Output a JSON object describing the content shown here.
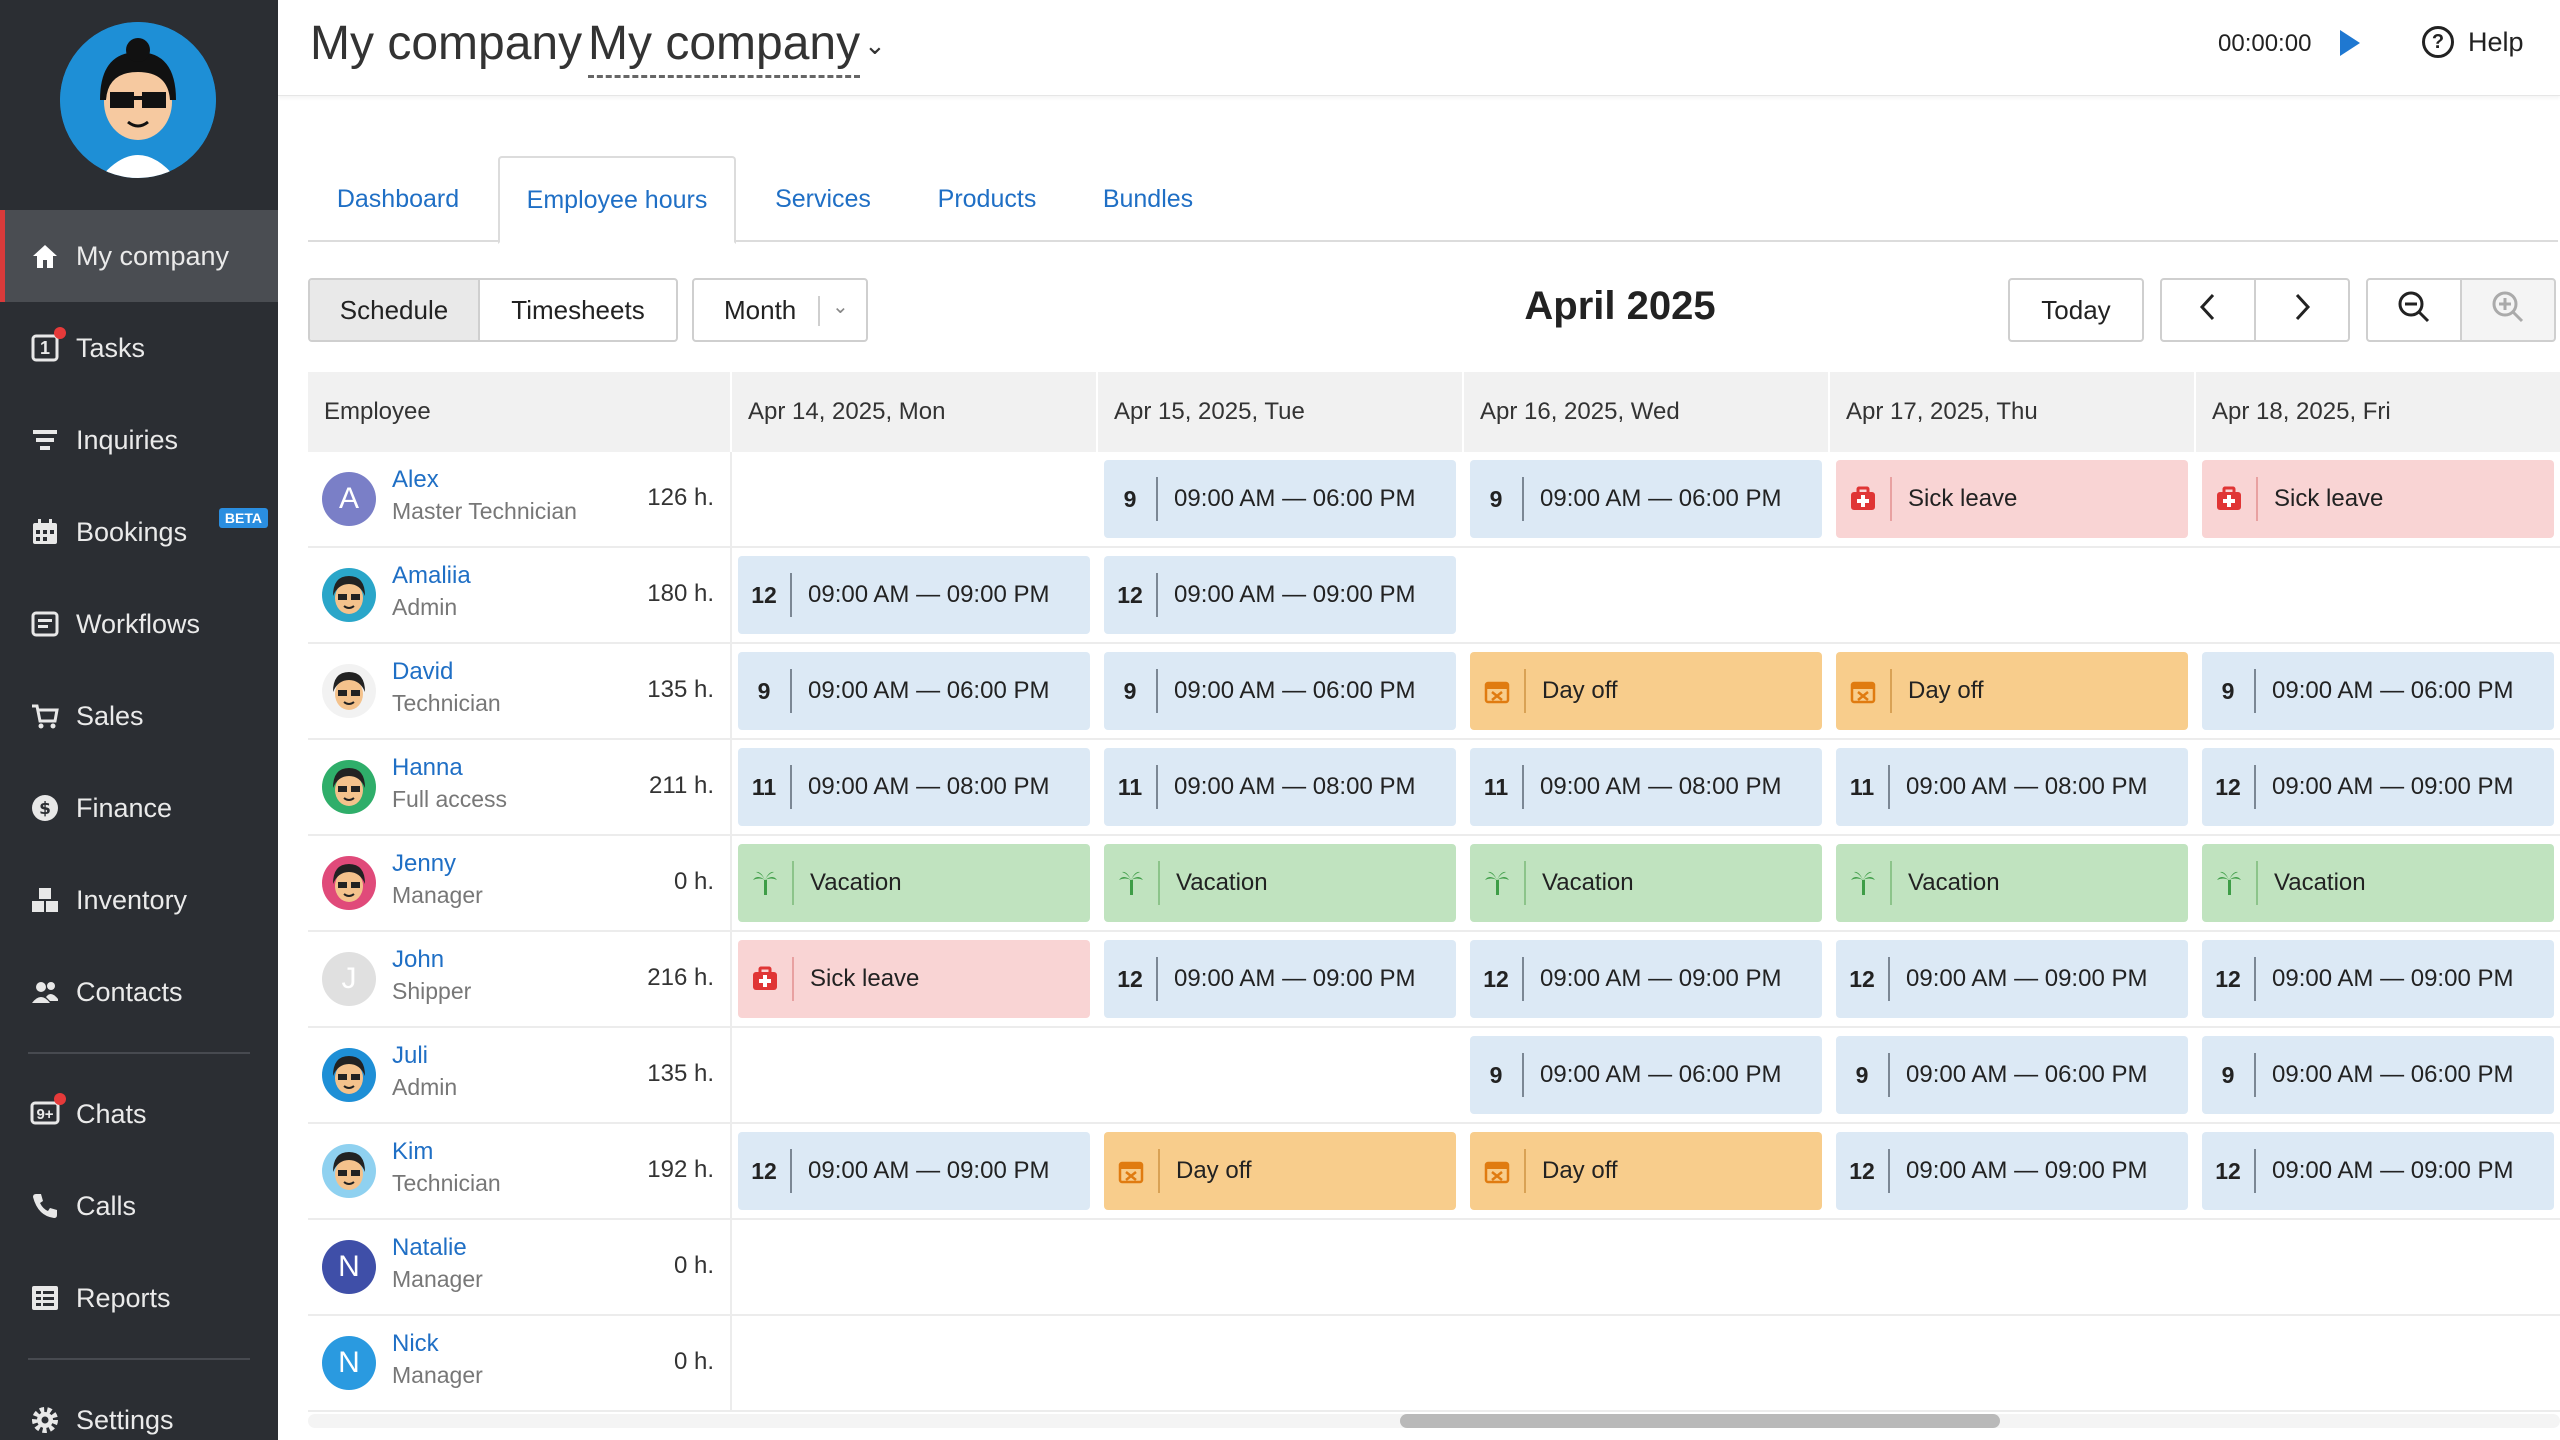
{
  "sidebar": {
    "items": [
      {
        "label": "My company",
        "icon": "home-icon",
        "active": true
      },
      {
        "label": "Tasks",
        "icon": "tasks-icon",
        "badge": "1"
      },
      {
        "label": "Inquiries",
        "icon": "filter-icon"
      },
      {
        "label": "Bookings",
        "icon": "calendar-icon",
        "tag": "BETA"
      },
      {
        "label": "Workflows",
        "icon": "workflow-icon"
      },
      {
        "label": "Sales",
        "icon": "cart-icon"
      },
      {
        "label": "Finance",
        "icon": "dollar-icon"
      },
      {
        "label": "Inventory",
        "icon": "boxes-icon"
      },
      {
        "label": "Contacts",
        "icon": "contacts-icon"
      },
      {
        "label": "Chats",
        "icon": "chat-icon",
        "badge": "9+"
      },
      {
        "label": "Calls",
        "icon": "phone-icon"
      },
      {
        "label": "Reports",
        "icon": "reports-icon"
      },
      {
        "label": "Settings",
        "icon": "gear-icon"
      }
    ]
  },
  "header": {
    "title": "My company",
    "company_select": "My company",
    "timer": "00:00:00",
    "help_label": "Help"
  },
  "tabs": [
    "Dashboard",
    "Employee hours",
    "Services",
    "Products",
    "Bundles"
  ],
  "toolbar": {
    "view_schedule": "Schedule",
    "view_timesheets": "Timesheets",
    "period_select": "Month",
    "period_title": "April 2025",
    "today_label": "Today"
  },
  "grid": {
    "employee_header": "Employee",
    "days": [
      "Apr 14, 2025, Mon",
      "Apr 15, 2025, Tue",
      "Apr 16, 2025, Wed",
      "Apr 17, 2025, Thu",
      "Apr 18, 2025, Fri"
    ],
    "employees": [
      {
        "name": "Alex",
        "role": "Master Technician",
        "hours": "126 h.",
        "avatar": "A",
        "avatar_color": "#7a7fc7",
        "cells": [
          null,
          {
            "type": "shift",
            "hrs": "9",
            "time": "09:00 AM — 06:00 PM"
          },
          {
            "type": "shift",
            "hrs": "9",
            "time": "09:00 AM — 06:00 PM"
          },
          {
            "type": "sick",
            "label": "Sick leave"
          },
          {
            "type": "sick",
            "label": "Sick leave"
          }
        ]
      },
      {
        "name": "Amaliia",
        "role": "Admin",
        "hours": "180 h.",
        "avatar": "",
        "avatar_color": "#2aa6c9",
        "cells": [
          {
            "type": "shift",
            "hrs": "12",
            "time": "09:00 AM — 09:00 PM"
          },
          {
            "type": "shift",
            "hrs": "12",
            "time": "09:00 AM — 09:00 PM"
          },
          null,
          null,
          null
        ]
      },
      {
        "name": "David",
        "role": "Technician",
        "hours": "135 h.",
        "avatar": "",
        "avatar_color": "#f2f2f2",
        "cells": [
          {
            "type": "shift",
            "hrs": "9",
            "time": "09:00 AM — 06:00 PM"
          },
          {
            "type": "shift",
            "hrs": "9",
            "time": "09:00 AM — 06:00 PM"
          },
          {
            "type": "off",
            "label": "Day off"
          },
          {
            "type": "off",
            "label": "Day off"
          },
          {
            "type": "shift",
            "hrs": "9",
            "time": "09:00 AM — 06:00 PM"
          }
        ]
      },
      {
        "name": "Hanna",
        "role": "Full access",
        "hours": "211 h.",
        "avatar": "",
        "avatar_color": "#2fae6a",
        "cells": [
          {
            "type": "shift",
            "hrs": "11",
            "time": "09:00 AM — 08:00 PM"
          },
          {
            "type": "shift",
            "hrs": "11",
            "time": "09:00 AM — 08:00 PM"
          },
          {
            "type": "shift",
            "hrs": "11",
            "time": "09:00 AM — 08:00 PM"
          },
          {
            "type": "shift",
            "hrs": "11",
            "time": "09:00 AM — 08:00 PM"
          },
          {
            "type": "shift",
            "hrs": "12",
            "time": "09:00 AM — 09:00 PM"
          }
        ]
      },
      {
        "name": "Jenny",
        "role": "Manager",
        "hours": "0 h.",
        "avatar": "",
        "avatar_color": "#e04a7a",
        "cells": [
          {
            "type": "vac",
            "label": "Vacation"
          },
          {
            "type": "vac",
            "label": "Vacation"
          },
          {
            "type": "vac",
            "label": "Vacation"
          },
          {
            "type": "vac",
            "label": "Vacation"
          },
          {
            "type": "vac",
            "label": "Vacation"
          }
        ]
      },
      {
        "name": "John",
        "role": "Shipper",
        "hours": "216 h.",
        "avatar": "J",
        "avatar_color": "#e0e0e0",
        "cells": [
          {
            "type": "sick",
            "label": "Sick leave"
          },
          {
            "type": "shift",
            "hrs": "12",
            "time": "09:00 AM — 09:00 PM"
          },
          {
            "type": "shift",
            "hrs": "12",
            "time": "09:00 AM — 09:00 PM"
          },
          {
            "type": "shift",
            "hrs": "12",
            "time": "09:00 AM — 09:00 PM"
          },
          {
            "type": "shift",
            "hrs": "12",
            "time": "09:00 AM — 09:00 PM"
          }
        ]
      },
      {
        "name": "Juli",
        "role": "Admin",
        "hours": "135 h.",
        "avatar": "",
        "avatar_color": "#1e8fd6",
        "cells": [
          null,
          null,
          {
            "type": "shift",
            "hrs": "9",
            "time": "09:00 AM — 06:00 PM"
          },
          {
            "type": "shift",
            "hrs": "9",
            "time": "09:00 AM — 06:00 PM"
          },
          {
            "type": "shift",
            "hrs": "9",
            "time": "09:00 AM — 06:00 PM"
          }
        ]
      },
      {
        "name": "Kim",
        "role": "Technician",
        "hours": "192 h.",
        "avatar": "",
        "avatar_color": "#8fd1f0",
        "cells": [
          {
            "type": "shift",
            "hrs": "12",
            "time": "09:00 AM — 09:00 PM"
          },
          {
            "type": "off",
            "label": "Day off"
          },
          {
            "type": "off",
            "label": "Day off"
          },
          {
            "type": "shift",
            "hrs": "12",
            "time": "09:00 AM — 09:00 PM"
          },
          {
            "type": "shift",
            "hrs": "12",
            "time": "09:00 AM — 09:00 PM"
          }
        ]
      },
      {
        "name": "Natalie",
        "role": "Manager",
        "hours": "0 h.",
        "avatar": "N",
        "avatar_color": "#3f4fa8",
        "cells": [
          null,
          null,
          null,
          null,
          null
        ]
      },
      {
        "name": "Nick",
        "role": "Manager",
        "hours": "0 h.",
        "avatar": "N",
        "avatar_color": "#2a9ae0",
        "cells": [
          null,
          null,
          null,
          null,
          null
        ]
      }
    ]
  },
  "colors": {
    "accent": "#1f6fc5",
    "sidebar_bg": "#2b2e33",
    "shift_bg": "#dce9f5",
    "sick_bg": "#f9d4d4",
    "dayoff_bg": "#f8cd8c",
    "vacation_bg": "#c0e3bf"
  }
}
